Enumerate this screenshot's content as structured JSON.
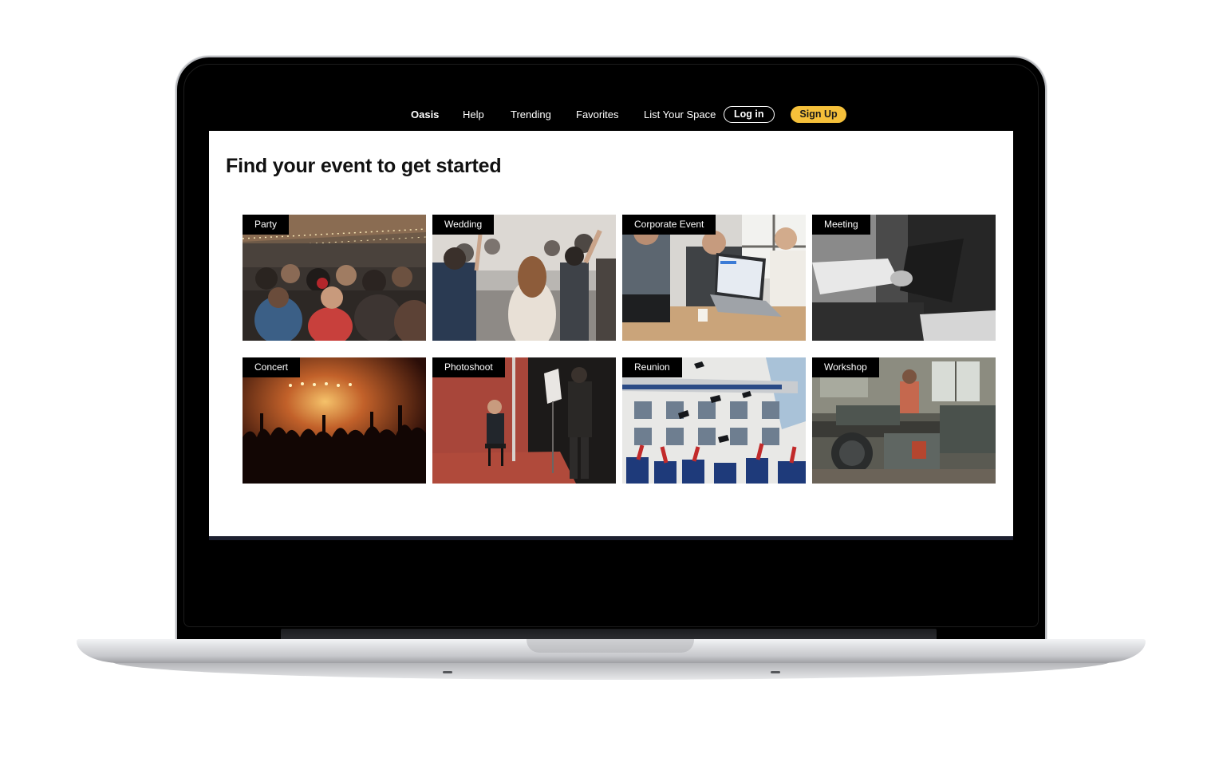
{
  "nav": {
    "brand": "Oasis",
    "links": [
      "Help",
      "Trending",
      "Favorites",
      "List Your Space"
    ],
    "login_label": "Log in",
    "signup_label": "Sign Up",
    "signup_color": "#f5c03a"
  },
  "main": {
    "title": "Find your event to get started",
    "categories": [
      {
        "label": "Party",
        "photo": "party-crowd-photo"
      },
      {
        "label": "Wedding",
        "photo": "wedding-celebration-photo"
      },
      {
        "label": "Corporate Event",
        "photo": "laptop-meeting-photo"
      },
      {
        "label": "Meeting",
        "photo": "handshake-photo"
      },
      {
        "label": "Concert",
        "photo": "concert-crowd-photo"
      },
      {
        "label": "Photoshoot",
        "photo": "studio-photoshoot-photo"
      },
      {
        "label": "Reunion",
        "photo": "graduation-caps-photo"
      },
      {
        "label": "Workshop",
        "photo": "machine-workshop-photo"
      }
    ]
  }
}
